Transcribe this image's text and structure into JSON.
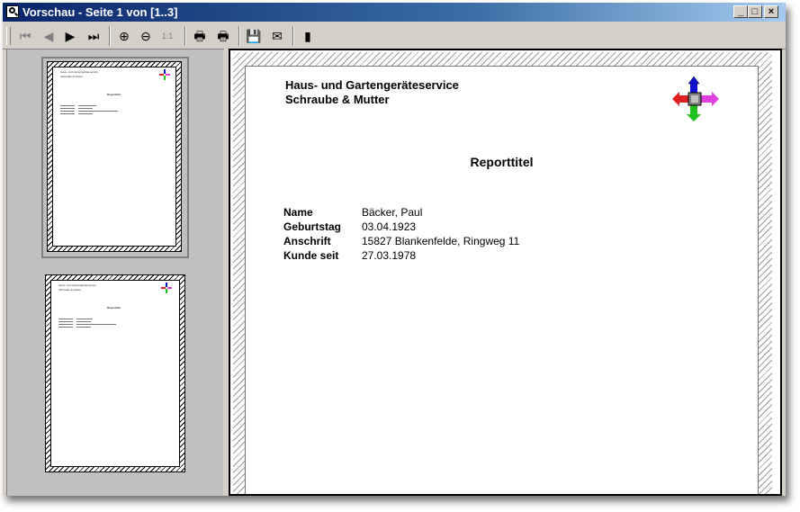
{
  "window": {
    "title": "Vorschau - Seite 1 von [1..3]",
    "controls": {
      "minimize": "_",
      "maximize": "□",
      "close": "×"
    }
  },
  "toolbar": {
    "buttons": [
      {
        "name": "first-page",
        "icon": "first-page-icon",
        "glyph": "⏮",
        "enabled": false
      },
      {
        "name": "previous-page",
        "icon": "previous-page-icon",
        "glyph": "◀",
        "enabled": false
      },
      {
        "name": "next-page",
        "icon": "next-page-icon",
        "glyph": "▶",
        "enabled": true
      },
      {
        "name": "last-page",
        "icon": "last-page-icon",
        "glyph": "⏭",
        "enabled": true
      },
      {
        "name": "zoom-in",
        "icon": "zoom-in-icon",
        "glyph": "⊕",
        "enabled": true
      },
      {
        "name": "zoom-out",
        "icon": "zoom-out-icon",
        "glyph": "⊖",
        "enabled": true
      },
      {
        "name": "actual-size",
        "icon": "actual-size-icon",
        "glyph": "1:1",
        "enabled": true
      },
      {
        "name": "print",
        "icon": "printer-icon",
        "glyph": "🖶",
        "enabled": true
      },
      {
        "name": "print-setup",
        "icon": "printer-setup-icon",
        "glyph": "🖶",
        "enabled": true
      },
      {
        "name": "save",
        "icon": "floppy-disk-icon",
        "glyph": "💾",
        "enabled": true
      },
      {
        "name": "email",
        "icon": "envelope-icon",
        "glyph": "✉",
        "enabled": true
      },
      {
        "name": "exit",
        "icon": "exit-door-icon",
        "glyph": "▮",
        "enabled": true
      }
    ]
  },
  "report": {
    "company_line1": "Haus- und Gartengeräteservice",
    "company_line2": "Schraube & Mutter",
    "title": "Reporttitel",
    "fields": [
      {
        "label": "Name",
        "value": "Bäcker, Paul"
      },
      {
        "label": "Geburtstag",
        "value": "03.04.1923"
      },
      {
        "label": "Anschrift",
        "value": "15827 Blankenfelde, Ringweg 11"
      },
      {
        "label": "Kunde seit",
        "value": "27.03.1978"
      }
    ]
  },
  "colors": {
    "titlebar_start": "#0a246a",
    "titlebar_end": "#a6caf0",
    "logo_up": "#1010d0",
    "logo_right": "#e040e0",
    "logo_down": "#20c020",
    "logo_left": "#e02020"
  }
}
